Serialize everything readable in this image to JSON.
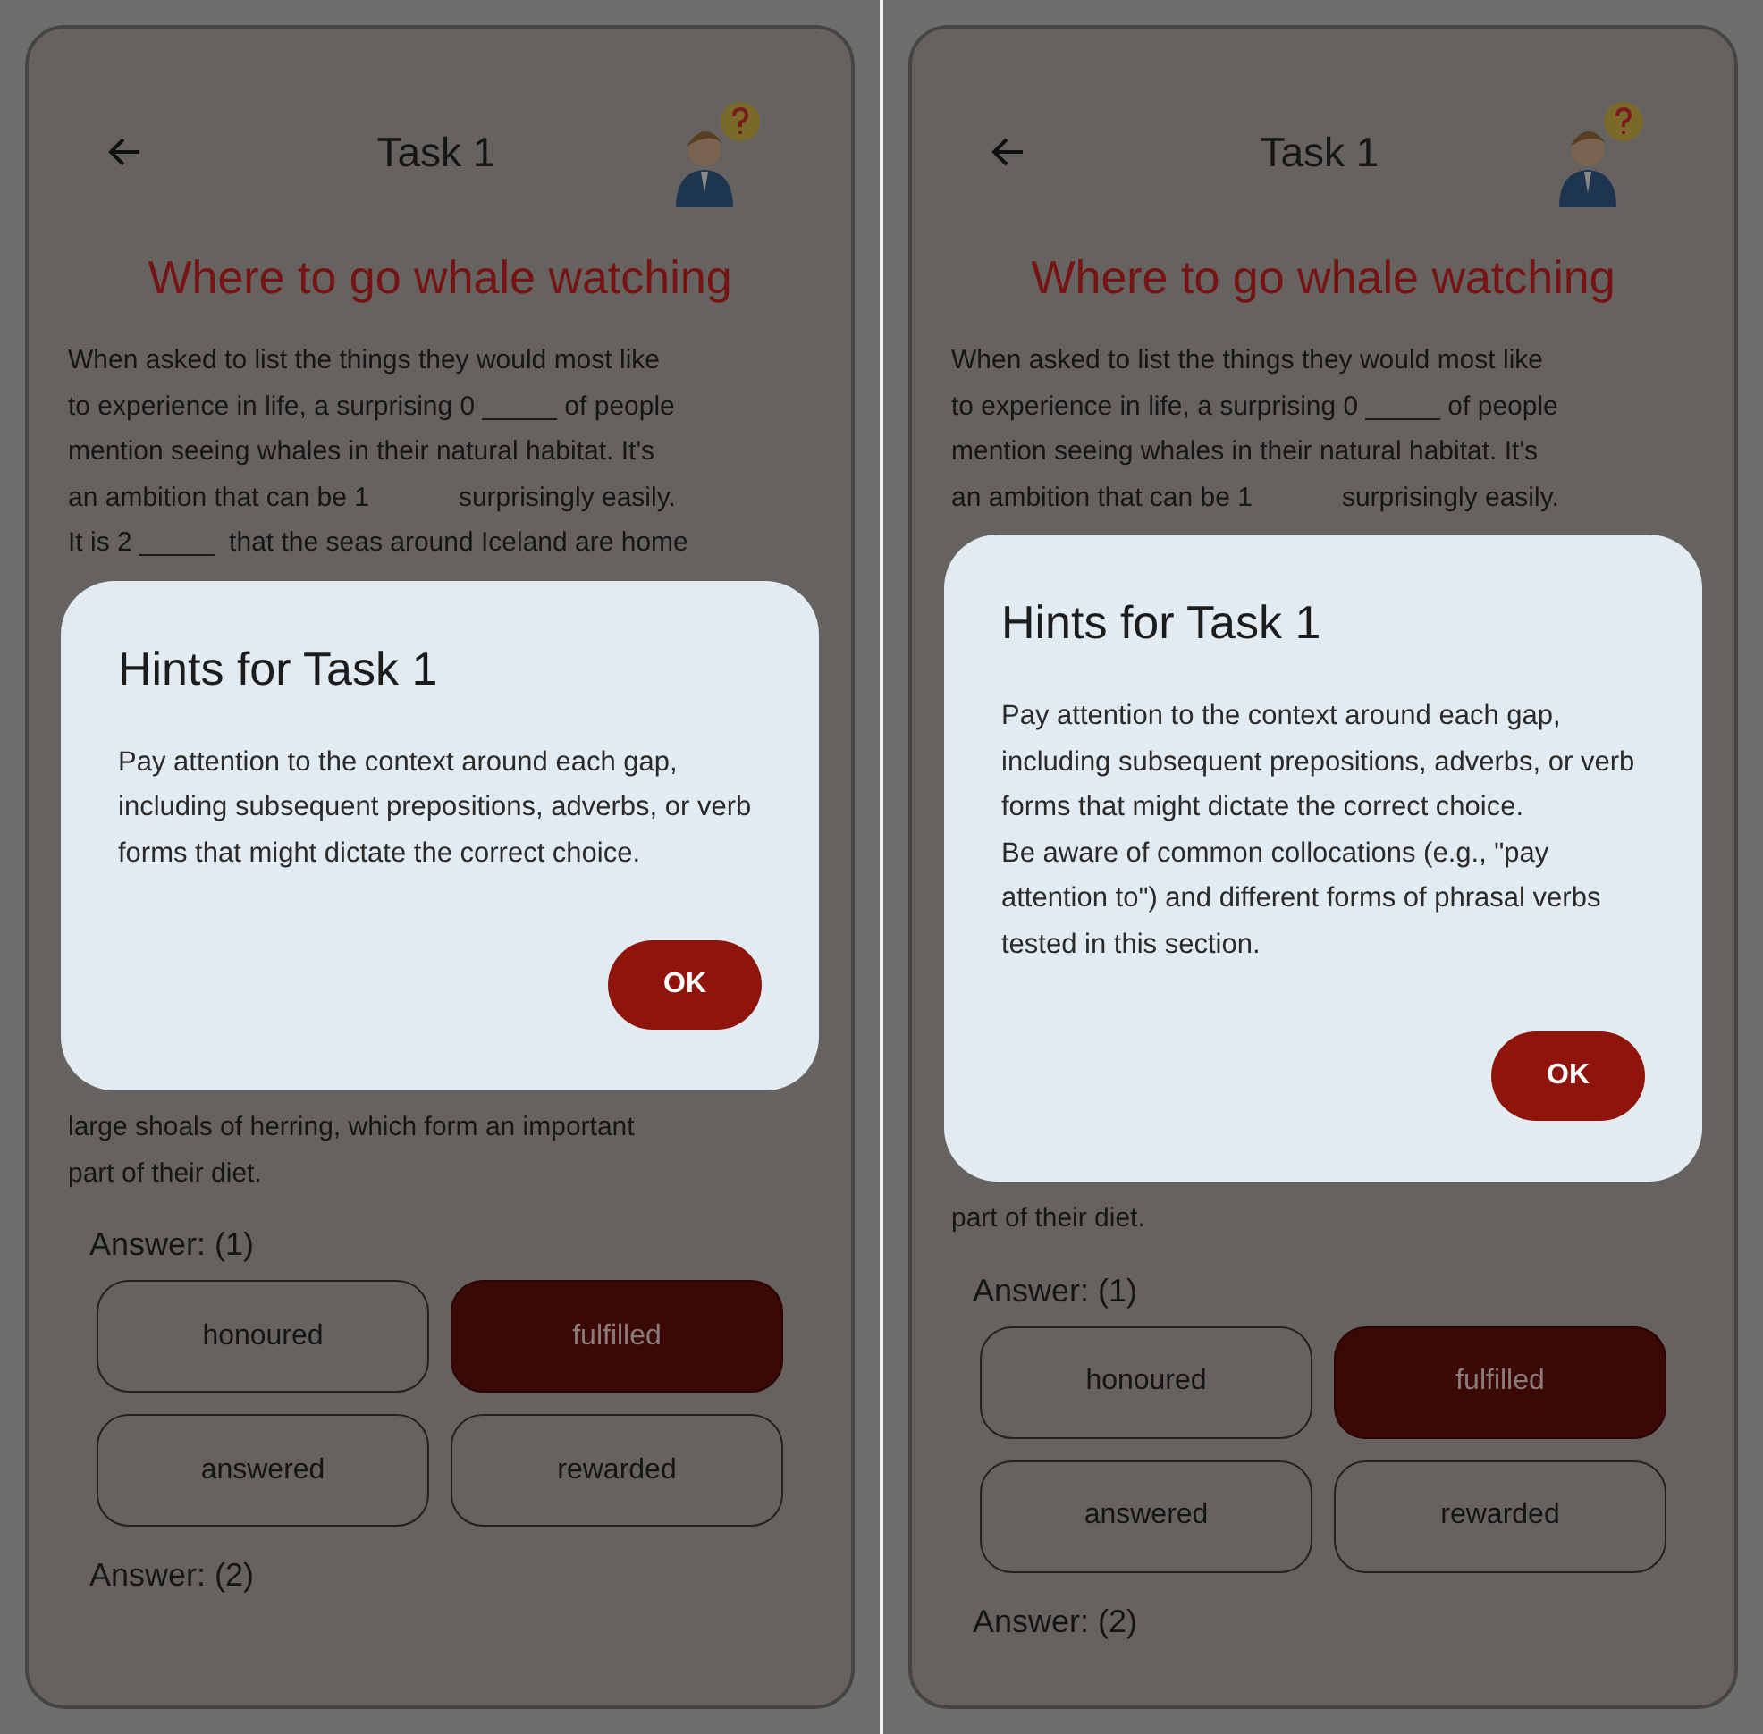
{
  "screens": [
    {
      "header": {
        "title": "Task 1"
      },
      "heading": "Where to go whale watching",
      "passage_above": [
        "When asked to list the things they would most like",
        "to experience in life, a surprising 0 _____ of people",
        "mention seeing whales in their natural habitat. It's",
        "an ambition that can be 1            surprisingly easily.",
        "It is 2 _____  that the seas around Iceland are home"
      ],
      "passage_below": [
        "large shoals of herring, which form an important",
        "part of their diet."
      ],
      "dialog": {
        "title": "Hints for Task 1",
        "paragraphs": [
          "Pay attention to the context around each gap, including subsequent prepositions, adverbs, or verb forms that might dictate the correct choice."
        ],
        "button": "OK"
      },
      "questions": [
        {
          "label": "Answer: (1)",
          "options": [
            {
              "label": "honoured",
              "selected": false
            },
            {
              "label": "fulfilled",
              "selected": true
            },
            {
              "label": "answered",
              "selected": false
            },
            {
              "label": "rewarded",
              "selected": false
            }
          ]
        },
        {
          "label": "Answer: (2)"
        }
      ]
    },
    {
      "header": {
        "title": "Task 1"
      },
      "heading": "Where to go whale watching",
      "passage_above": [
        "When asked to list the things they would most like",
        "to experience in life, a surprising 0 _____ of people",
        "mention seeing whales in their natural habitat. It's",
        "an ambition that can be 1            surprisingly easily."
      ],
      "passage_below": [
        "part of their diet."
      ],
      "dialog": {
        "title": "Hints for Task 1",
        "paragraphs": [
          "Pay attention to the context around each gap, including subsequent prepositions, adverbs, or verb forms that might dictate the correct choice.",
          "Be aware of common collocations (e.g., \"pay attention to\") and different forms of phrasal verbs tested in this section."
        ],
        "button": "OK"
      },
      "questions": [
        {
          "label": "Answer: (1)",
          "options": [
            {
              "label": "honoured",
              "selected": false
            },
            {
              "label": "fulfilled",
              "selected": true
            },
            {
              "label": "answered",
              "selected": false
            },
            {
              "label": "rewarded",
              "selected": false
            }
          ]
        },
        {
          "label": "Answer: (2)"
        }
      ]
    }
  ]
}
